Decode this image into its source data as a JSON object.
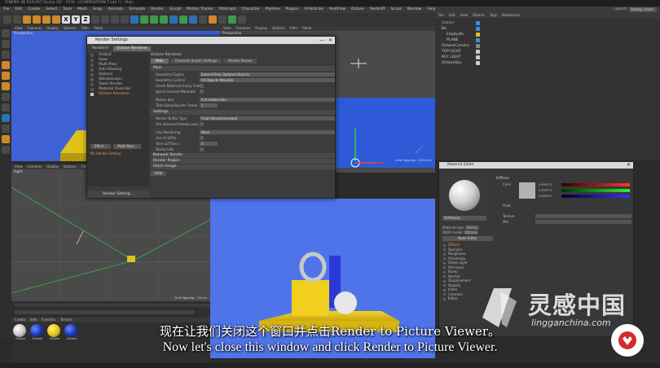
{
  "app": {
    "title": "CINEMA 4D R19.057 Studio (RC - R19) - [COMPOSITION T.c4d *] - Main",
    "menu": [
      "File",
      "Edit",
      "Create",
      "Select",
      "Tools",
      "Mesh",
      "Snap",
      "Animate",
      "Simulate",
      "Render",
      "Sculpt",
      "Motion Tracker",
      "MoGraph",
      "Character",
      "Pipeline",
      "Plugins",
      "X-Particles",
      "RealFlow",
      "Octane",
      "Redshift",
      "Script",
      "Window",
      "Help"
    ],
    "layout_label": "Layout:",
    "layout_value": "Startup (User)"
  },
  "toolbar": {
    "axis_x": "X",
    "axis_y": "Y",
    "axis_z": "Z"
  },
  "viewports": {
    "top": {
      "name": "Perspective",
      "menu": [
        "View",
        "Cameras",
        "Display",
        "Options",
        "Filter",
        "Panel"
      ]
    },
    "top2": {
      "name": "Perspective",
      "menu": [
        "View",
        "Cameras",
        "Display",
        "Options",
        "Filter",
        "Panel"
      ],
      "grid_spacing": "Grid Spacing : 1000 cm"
    },
    "bottom": {
      "name": "Right",
      "menu": [
        "View",
        "Cameras",
        "Display",
        "Options",
        "Filter",
        "Panel"
      ],
      "grid_spacing": "Grid Spacing : 10 cm"
    }
  },
  "material_manager": {
    "menu": [
      "Create",
      "Edit",
      "Function",
      "Texture"
    ],
    "materials": [
      {
        "name": "Octane",
        "color": "#c9c9c9"
      },
      {
        "name": "Octane",
        "color": "#1a37b8"
      },
      {
        "name": "Octane",
        "color": "#e0c21a"
      },
      {
        "name": "Octane",
        "color": "#1a37b8"
      }
    ]
  },
  "object_manager": {
    "menu": [
      "File",
      "Edit",
      "View",
      "Objects",
      "Tags",
      "Bookmarks"
    ],
    "objects": [
      {
        "name": "Subdiv",
        "tag": "#3c8ee0",
        "active": true
      },
      {
        "name": "Bo",
        "tag": "#3c8ee0",
        "active": false
      },
      {
        "name": "Empty.Bo",
        "tag": "#e0c21a",
        "active": false
      },
      {
        "name": "PLANE",
        "tag": "#3c8ee0",
        "active": false
      },
      {
        "name": "OctaneCamera",
        "tag": "#888888",
        "active": false
      },
      {
        "name": "TOP LIGHT",
        "tag": "#cccccc",
        "active": false
      },
      {
        "name": "KEY LIGHT",
        "tag": "#cccccc",
        "active": false
      },
      {
        "name": "OctaneSky",
        "tag": "#cccccc",
        "active": false
      }
    ]
  },
  "render_settings": {
    "title": "Render Settings",
    "renderer_label": "Renderer",
    "renderer_value": "Octane Renderer",
    "left_items": [
      {
        "label": "Output",
        "selected": false
      },
      {
        "label": "Save",
        "selected": false
      },
      {
        "label": "Multi-Pass",
        "selected": false
      },
      {
        "label": "Anti-Aliasing",
        "selected": false
      },
      {
        "label": "Options",
        "selected": false
      },
      {
        "label": "Stereoscopic",
        "selected": false
      },
      {
        "label": "Team Render",
        "selected": false
      },
      {
        "label": "Material Override",
        "selected": false
      },
      {
        "label": "Octane Renderer",
        "selected": true
      }
    ],
    "effect_button": "Effect...",
    "multipass_button": "Multi-Pass...",
    "my_render_setting": "My Render Setting",
    "render_setting_button": "Render Setting...",
    "section_title": "Octane Renderer",
    "tabs": [
      {
        "label": "Main",
        "active": true
      },
      {
        "label": "Channels (Layer) Settings",
        "active": false
      },
      {
        "label": "Render Passes",
        "active": false
      }
    ],
    "group_main": "Main",
    "main_params": [
      {
        "label": "Geometry Engine",
        "value": "Extend Only Updated Objects"
      },
      {
        "label": "Geometry Control",
        "value": "All Objects Movable"
      },
      {
        "label": "Check Materials Every Frame",
        "value": ""
      },
      {
        "label": "Ignore Unused Materials",
        "value": ""
      },
      {
        "label": "Motion blur",
        "value": "Full motion blur"
      },
      {
        "label": "Time Sampling Per Frame",
        "value": "1"
      }
    ],
    "group_settings": "Settings",
    "settings_params": [
      {
        "label": "Render Buffer Type",
        "value": "Float (Recommended)"
      },
      {
        "label": "Use denoised beauty pass",
        "value": ""
      },
      {
        "label": "Clay Rendering",
        "value": "None"
      },
      {
        "label": "Use All GPUs",
        "value": ""
      },
      {
        "label": "Tone LUT(Sec.)",
        "value": "0"
      },
      {
        "label": "Stamp Info",
        "value": ""
      }
    ],
    "collapsed_groups": [
      "Network Render",
      "Render Region",
      "Stitch Image"
    ],
    "help_button": "Help"
  },
  "material_editor": {
    "title": "Material Editor",
    "material_name": "OctGlossy",
    "channels": [
      "Diffuse",
      "Specular",
      "Roughness",
      "Anisotropy",
      "Sheen layer",
      "Film layer",
      "Bump",
      "Normal",
      "Displacement",
      "Opacity",
      "Index",
      "Common",
      "Editor"
    ],
    "section": "Diffuse",
    "color_label": "Color",
    "float_label": "Float",
    "texture_label": "Texture",
    "mix_label": "Mix",
    "material_type_label": "Material type",
    "material_type_value": "Glossy",
    "brdf_label": "BRDF model",
    "brdf_value": "Octane",
    "node_editor": "Node Editor",
    "rgb": {
      "r": "0.699371",
      "g": "0.699371",
      "b": "0.699371"
    }
  },
  "subtitles": {
    "cn": "现在让我们关闭这个窗口并点击Render to Picture Viewer。",
    "en": "Now let's close this window and click Render to Picture Viewer."
  },
  "watermark": {
    "cn": "灵感中国",
    "en": "lingganchina.com"
  },
  "colors": {
    "sky_blue": "#3f62d6",
    "render_blue": "#4f74ea",
    "yellow": "#e0c21a",
    "accent_orange": "#e9964a"
  }
}
